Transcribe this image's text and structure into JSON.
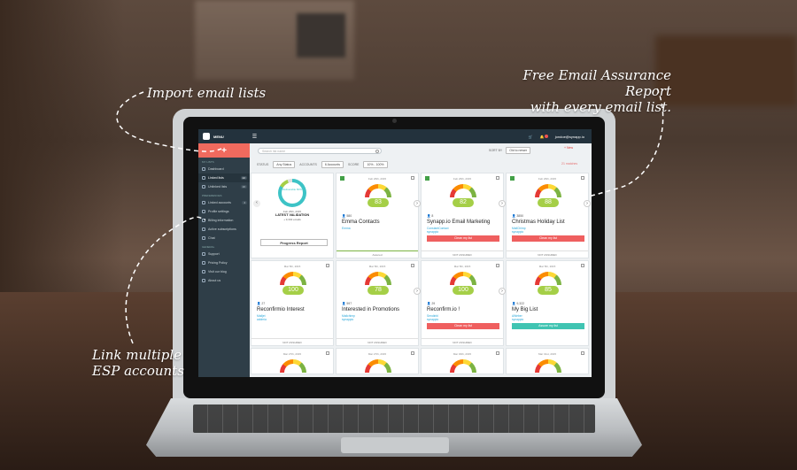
{
  "annotations": {
    "import": "Import email lists",
    "report_line1": "Free Email Assurance Report",
    "report_line2": "with every email list.",
    "link_line1": "Link multiple",
    "link_line2": "ESP accounts"
  },
  "topbar": {
    "menu": "MENU",
    "user": "jondoe@synapp.io"
  },
  "sidebar": {
    "add": "+",
    "section_lists": "MY LISTS",
    "items_lists": [
      {
        "label": "Dashboard",
        "count": ""
      },
      {
        "label": "Linked lists",
        "count": "22"
      },
      {
        "label": "Unlinked lists",
        "count": "16"
      }
    ],
    "section_prefs": "PREFERENCES",
    "items_prefs": [
      {
        "label": "Linked accounts",
        "count": "4"
      },
      {
        "label": "Profile settings",
        "count": ""
      },
      {
        "label": "Billing information",
        "count": ""
      },
      {
        "label": "Active subscriptions",
        "count": ""
      },
      {
        "label": "Chat",
        "count": ""
      }
    ],
    "section_general": "GENERAL",
    "items_general": [
      {
        "label": "Support"
      },
      {
        "label": "Pricing Policy"
      },
      {
        "label": "Visit our blog"
      },
      {
        "label": "About us"
      }
    ]
  },
  "toolbar": {
    "search_placeholder": "Search list name",
    "sort_by": "SORT BY",
    "sort_value": "Old to newer",
    "new_list": "+ New",
    "status_label": "STATUS",
    "status_value": "Any Status",
    "accounts_label": "ACCOUNTS",
    "accounts_value": "6 Accounts",
    "score_label": "SCORE",
    "score_value": "10% - 100%",
    "matches": "21 matches"
  },
  "summary": {
    "ring_label": "Deliverable 80%",
    "date": "Feb 26th, 2015",
    "title": "LATEST VALIDATION",
    "sub": "+ 9,302 emails",
    "button": "Progress Report"
  },
  "cards": [
    {
      "date": "Feb 26th, 2015",
      "score": "83",
      "meta": "580",
      "name": "Emma Contacts",
      "link1": "Emma",
      "link2": "",
      "button": "",
      "footer": "Assured",
      "flag": true
    },
    {
      "date": "Feb 26th, 2015",
      "score": "82",
      "meta": "8",
      "name": "Synapp.io Email Marketing",
      "link1": "ConstantContact",
      "link2": "synappio",
      "button": "Clean my list",
      "footer": "NOT ASSURED",
      "flag": true
    },
    {
      "date": "Feb 26th, 2015",
      "score": "88",
      "meta": "3850",
      "name": "Christmas Holiday List",
      "link1": "MailChimp",
      "link2": "synappio",
      "button": "Clean my list",
      "footer": "NOT ASSURED",
      "flag": true
    },
    {
      "date": "Mar 5th, 2015",
      "score": "100",
      "meta": "27",
      "name": "Reconfirmio Interest",
      "link1": "Mailjet",
      "link2": "addmia",
      "button": "",
      "footer": "NOT ASSURED",
      "flag": false
    },
    {
      "date": "Mar 5th, 2015",
      "score": "78",
      "meta": "597",
      "name": "Interested in Promotions",
      "link1": "Mailchimp",
      "link2": "synappio",
      "button": "",
      "footer": "NOT ASSURED",
      "flag": false
    },
    {
      "date": "Mar 5th, 2015",
      "score": "100",
      "meta": "29",
      "name": "Reconfirm.io !",
      "link1": "Sendinbl",
      "link2": "synappio",
      "button": "Clean my list",
      "footer": "NOT ASSURED",
      "flag": false
    },
    {
      "date": "Mar 5th, 2015",
      "score": "85",
      "meta": "9,322",
      "name": "My Big List",
      "link1": "AWeber",
      "link2": "synappio",
      "button": "Assure my list",
      "footer": "",
      "flag": false
    }
  ],
  "row3_dates": [
    "Mar 27th, 2015",
    "Mar 27th, 2015",
    "Mar 30th, 2015",
    "Mar 31st, 2015"
  ],
  "colors": {
    "accent": "#f06a5e",
    "sidebar": "#2f3e48",
    "score": "#a5cf47",
    "teal": "#40c4b2"
  }
}
